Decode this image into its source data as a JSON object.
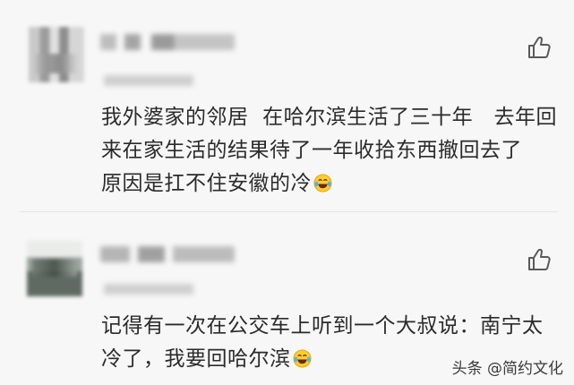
{
  "comments": [
    {
      "text": "我外婆家的邻居  在哈尔滨生活了三十年   去年回来在家生活的结果待了一年收拾东西撤回去了    原因是扛不住安徽的冷",
      "emoji": "laughing-tears-icon"
    },
    {
      "text": "记得有一次在公交车上听到一个大叔说：南宁太冷了，我要回哈尔滨",
      "emoji": "laughing-tears-icon"
    }
  ],
  "watermark": "头条 @简约文化",
  "colors": {
    "background": "#f7f7f7",
    "text": "#2b2b2b",
    "icon": "#5a5a5a"
  }
}
